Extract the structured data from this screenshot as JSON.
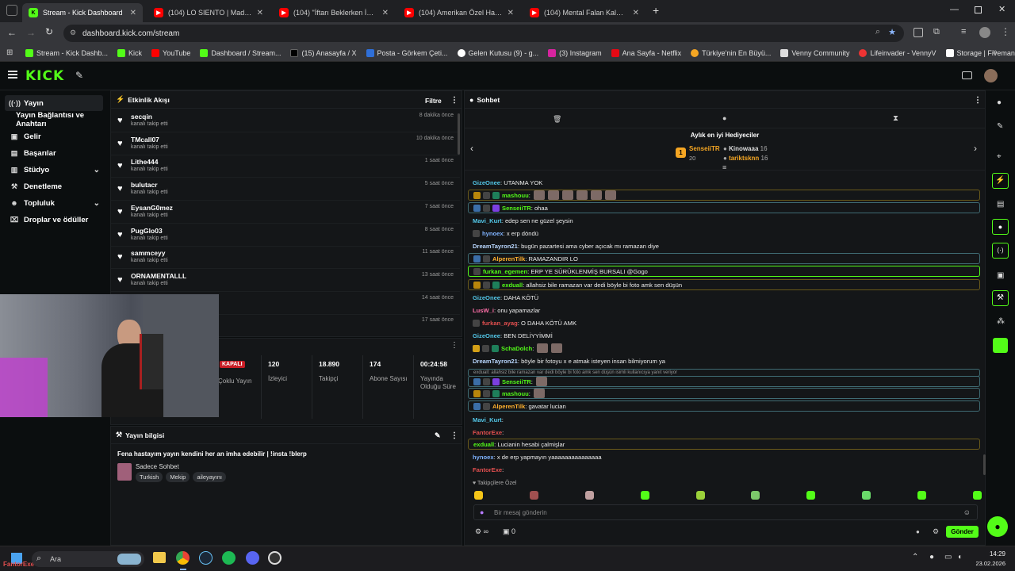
{
  "browser": {
    "tabs": [
      {
        "title": "Stream - Kick Dashboard",
        "active": true
      },
      {
        "title": "(104) LO SIENTO | Madara Oldu"
      },
      {
        "title": "(104) \"İftarı Beklerken İzlemelik"
      },
      {
        "title": "(104) Amerikan Özel Harekâtı"
      },
      {
        "title": "(104) Mental Falan Kalmadı Ya |"
      }
    ],
    "url": "dashboard.kick.com/stream",
    "bookmarks": [
      "Stream - Kick Dashb...",
      "Kick",
      "YouTube",
      "Dashboard / Stream...",
      "(15) Anasayfa / X",
      "Posta - Görkem Çeti...",
      "Gelen Kutusu (9) - g...",
      "(3) Instagram",
      "Ana Sayfa - Netflix",
      "Türkiye'nin En Büyü...",
      "Venny Community",
      "Lifeinvader - VennyV",
      "Storage | Fivemanage"
    ]
  },
  "header": {
    "logo": "KICK"
  },
  "sidebar": {
    "items": [
      {
        "label": "Yayın",
        "icon": "broadcast-icon",
        "active": true
      },
      {
        "label": "Yayın Bağlantısı ve Anahtarı",
        "icon": ""
      },
      {
        "label": "Gelir",
        "icon": "wallet-icon"
      },
      {
        "label": "Başarılar",
        "icon": "trophy-icon"
      },
      {
        "label": "Stüdyo",
        "icon": "studio-icon",
        "expand": true
      },
      {
        "label": "Denetleme",
        "icon": "hammer-icon"
      },
      {
        "label": "Topluluk",
        "icon": "users-icon",
        "expand": true
      },
      {
        "label": "Droplar ve ödüller",
        "icon": "gift-icon"
      }
    ]
  },
  "activity": {
    "title": "Etkinlik Akışı",
    "filter_label": "Filtre",
    "items": [
      {
        "name": "secqin",
        "sub": "kanalı takip etti",
        "time": "8 dakika önce"
      },
      {
        "name": "TMcalI07",
        "sub": "kanalı takip etti",
        "time": "10 dakika önce"
      },
      {
        "name": "Lithe444",
        "sub": "kanalı takip etti",
        "time": "1 saat önce"
      },
      {
        "name": "bulutacr",
        "sub": "kanalı takip etti",
        "time": "5 saat önce"
      },
      {
        "name": "EysanG0mez",
        "sub": "kanalı takip etti",
        "time": "7 saat önce"
      },
      {
        "name": "PugGlo03",
        "sub": "kanalı takip etti",
        "time": "8 saat önce"
      },
      {
        "name": "sammceyy",
        "sub": "kanalı takip etti",
        "time": "11 saat önce"
      },
      {
        "name": "ORNAMENTALLL",
        "sub": "kanalı takip etti",
        "time": "13 saat önce"
      },
      {
        "name": "",
        "sub": "",
        "time": "14 saat önce"
      },
      {
        "name": "",
        "sub": "",
        "time": "17 saat önce"
      }
    ]
  },
  "stats": {
    "mode_badge": "KAPALI",
    "mode_label": "Çoklu Yayın",
    "viewers": {
      "value": "120",
      "label": "İzleyici"
    },
    "followers": {
      "value": "18.890",
      "label": "Takipçi"
    },
    "subs": {
      "value": "174",
      "label": "Abone Sayısı"
    },
    "uptime": {
      "value": "00:24:58",
      "label": "Yayında Olduğu Süre"
    }
  },
  "stream_info": {
    "title": "Yayın bilgisi",
    "stream_title": "Fena hastayım yayın kendini her an imha edebilir | !insta !blerp",
    "category": "Sadece Sohbet",
    "tags": [
      "Turkish",
      "Mekip",
      "aileyayını"
    ]
  },
  "chat": {
    "title": "Sohbet",
    "gifters_title": "Aylık en iyi Hediyeciler",
    "gifters": [
      {
        "rank": "1",
        "name": "SenseiiTR",
        "count": "20"
      },
      {
        "name": "Kinowaaa",
        "count": "16"
      },
      {
        "name": "tariktsknn",
        "count": "16"
      }
    ],
    "messages": [
      {
        "user": "GizeOnee",
        "color": "#53c7e8",
        "text": ": UTANMA YOK",
        "style": ""
      },
      {
        "user": "mashouu",
        "color": "#53fc18",
        "text": ":",
        "style": "hly",
        "badges": [
          "#b8860b",
          "#444",
          "#1e7f5a"
        ],
        "emotes": 6
      },
      {
        "user": "SenseiiTR",
        "color": "#53fc18",
        "text": ": ohaa",
        "style": "hl",
        "badges": [
          "#3b6ea8",
          "#444",
          "#7b3fe0"
        ]
      },
      {
        "user": "Mavi_Kurt",
        "color": "#53c7e8",
        "text": ": edep sen ne güzel şeysin",
        "style": ""
      },
      {
        "user": "hynoex",
        "color": "#7fb3ff",
        "text": ": x erp döndü",
        "style": "",
        "badges": [
          "#444"
        ]
      },
      {
        "user": "DreamTayron21",
        "color": "#b9d7ff",
        "text": ": bugün pazartesi ama cyber açıcak mı ramazan diye",
        "style": ""
      },
      {
        "user": "AlperenTilk",
        "color": "#ffb02e",
        "text": ": RAMAZANDIR LO",
        "style": "hl",
        "badges": [
          "#3b6ea8",
          "#444"
        ]
      },
      {
        "user": "furkan_egemen",
        "color": "#53fc18",
        "text": ": ERP YE SÜRÜKLENMİŞ BURSALI @Gogo",
        "style": "hlg",
        "badges": [
          "#444"
        ]
      },
      {
        "user": "exduall",
        "color": "#53fc18",
        "text": ": allahsiz bile ramazan var dedi böyle bi foto amk sen düşün",
        "style": "hly",
        "badges": [
          "#b8860b",
          "#444",
          "#1e7f5a"
        ]
      },
      {
        "user": "GizeOnee",
        "color": "#53c7e8",
        "text": ": DAHA KÖTÜ",
        "style": ""
      },
      {
        "user": "LusW_i",
        "color": "#ff6fa8",
        "text": ": onu yapamazlar",
        "style": ""
      },
      {
        "user": "furkan_ayag",
        "color": "#e24f4f",
        "text": ": O DAHA KÖTÜ AMK",
        "style": "",
        "badges": [
          "#444"
        ]
      },
      {
        "user": "GizeOnee",
        "color": "#53c7e8",
        "text": ": BEN DELİYYİMMİ",
        "style": ""
      },
      {
        "user": "SchaDolch",
        "color": "#53fc18",
        "text": ":",
        "style": "",
        "badges": [
          "#d4a017",
          "#444",
          "#1e7f5a"
        ],
        "emotes": 2
      },
      {
        "user": "DreamTayron21",
        "color": "#b9d7ff",
        "text": ": böyle bir fotoyu x e atmak isteyen insan bilmiyorum ya",
        "style": ""
      }
    ],
    "reply_preview": "exduall: allahsiz bile ramazan var dedi böyle bi foto amk sen düşün isimli kullanıcıya yanıt veriyor",
    "messages2": [
      {
        "user": "SenseiiTR",
        "color": "#53fc18",
        "text": ":",
        "badges": [
          "#3b6ea8",
          "#444",
          "#7b3fe0"
        ],
        "emotes": 1
      },
      {
        "user": "mashouu",
        "color": "#53fc18",
        "text": ":",
        "badges": [
          "#b8860b",
          "#444",
          "#1e7f5a"
        ],
        "emotes": 1
      },
      {
        "user": "AlperenTilk",
        "color": "#ffb02e",
        "text": ": gavatar lucian",
        "badges": [
          "#3b6ea8",
          "#444"
        ]
      }
    ],
    "messages3": [
      {
        "user": "Mavi_Kurt",
        "color": "#53c7e8",
        "text": ":"
      },
      {
        "user": "FantorExe",
        "color": "#e24f4f",
        "text": ":"
      },
      {
        "user": "exduall",
        "color": "#53fc18",
        "text": ": Lucianin hesabi çalmişlar"
      },
      {
        "user": "hynoex",
        "color": "#7fb3ff",
        "text": ": x de erp yapmayın yaaaaaaaaaaaaaaa"
      },
      {
        "user": "FantorExe",
        "color": "#e24f4f",
        "text": ":"
      }
    ],
    "followers_only": "Takipçilere Özel",
    "input_placeholder": "Bir mesaj gönderin",
    "send_label": "Gönder",
    "points": "0",
    "infinity": "∞"
  },
  "taskbar": {
    "search_placeholder": "Ara",
    "time": "14:29",
    "date": "23.02.2026",
    "webcam_label": "FantorExe"
  },
  "colors": {
    "accent": "#53fc18",
    "bg": "#0b0e0f",
    "panel": "#141618"
  }
}
